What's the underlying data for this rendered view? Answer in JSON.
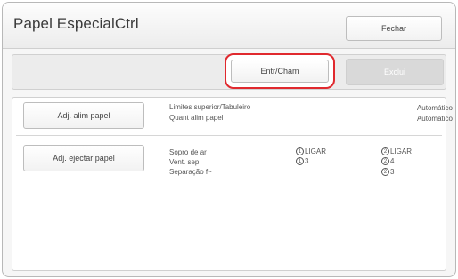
{
  "window": {
    "title": "Papel EspecialCtrl",
    "close_label": "Fechar"
  },
  "toolbar": {
    "entry_label": "Entr/Cham",
    "delete_label": "Exclui"
  },
  "feed_section": {
    "button_label": "Adj. alim papel",
    "rows": [
      {
        "label": "Limites superior/Tabuleiro",
        "value": "Automático"
      },
      {
        "label": "Quant alim papel",
        "value": "Automático"
      }
    ]
  },
  "eject_section": {
    "button_label": "Adj. ejectar papel",
    "rows": [
      {
        "label": "Sopro de ar",
        "col1_badge": "1",
        "col1": "LIGAR",
        "col2_badge": "2",
        "col2": "LIGAR"
      },
      {
        "label": "Vent. sep",
        "col1_badge": "1",
        "col1": "3",
        "col2_badge": "2",
        "col2": "4"
      },
      {
        "label": "Separação f~",
        "col1_badge": "",
        "col1": "",
        "col2_badge": "2",
        "col2": "3"
      }
    ]
  }
}
